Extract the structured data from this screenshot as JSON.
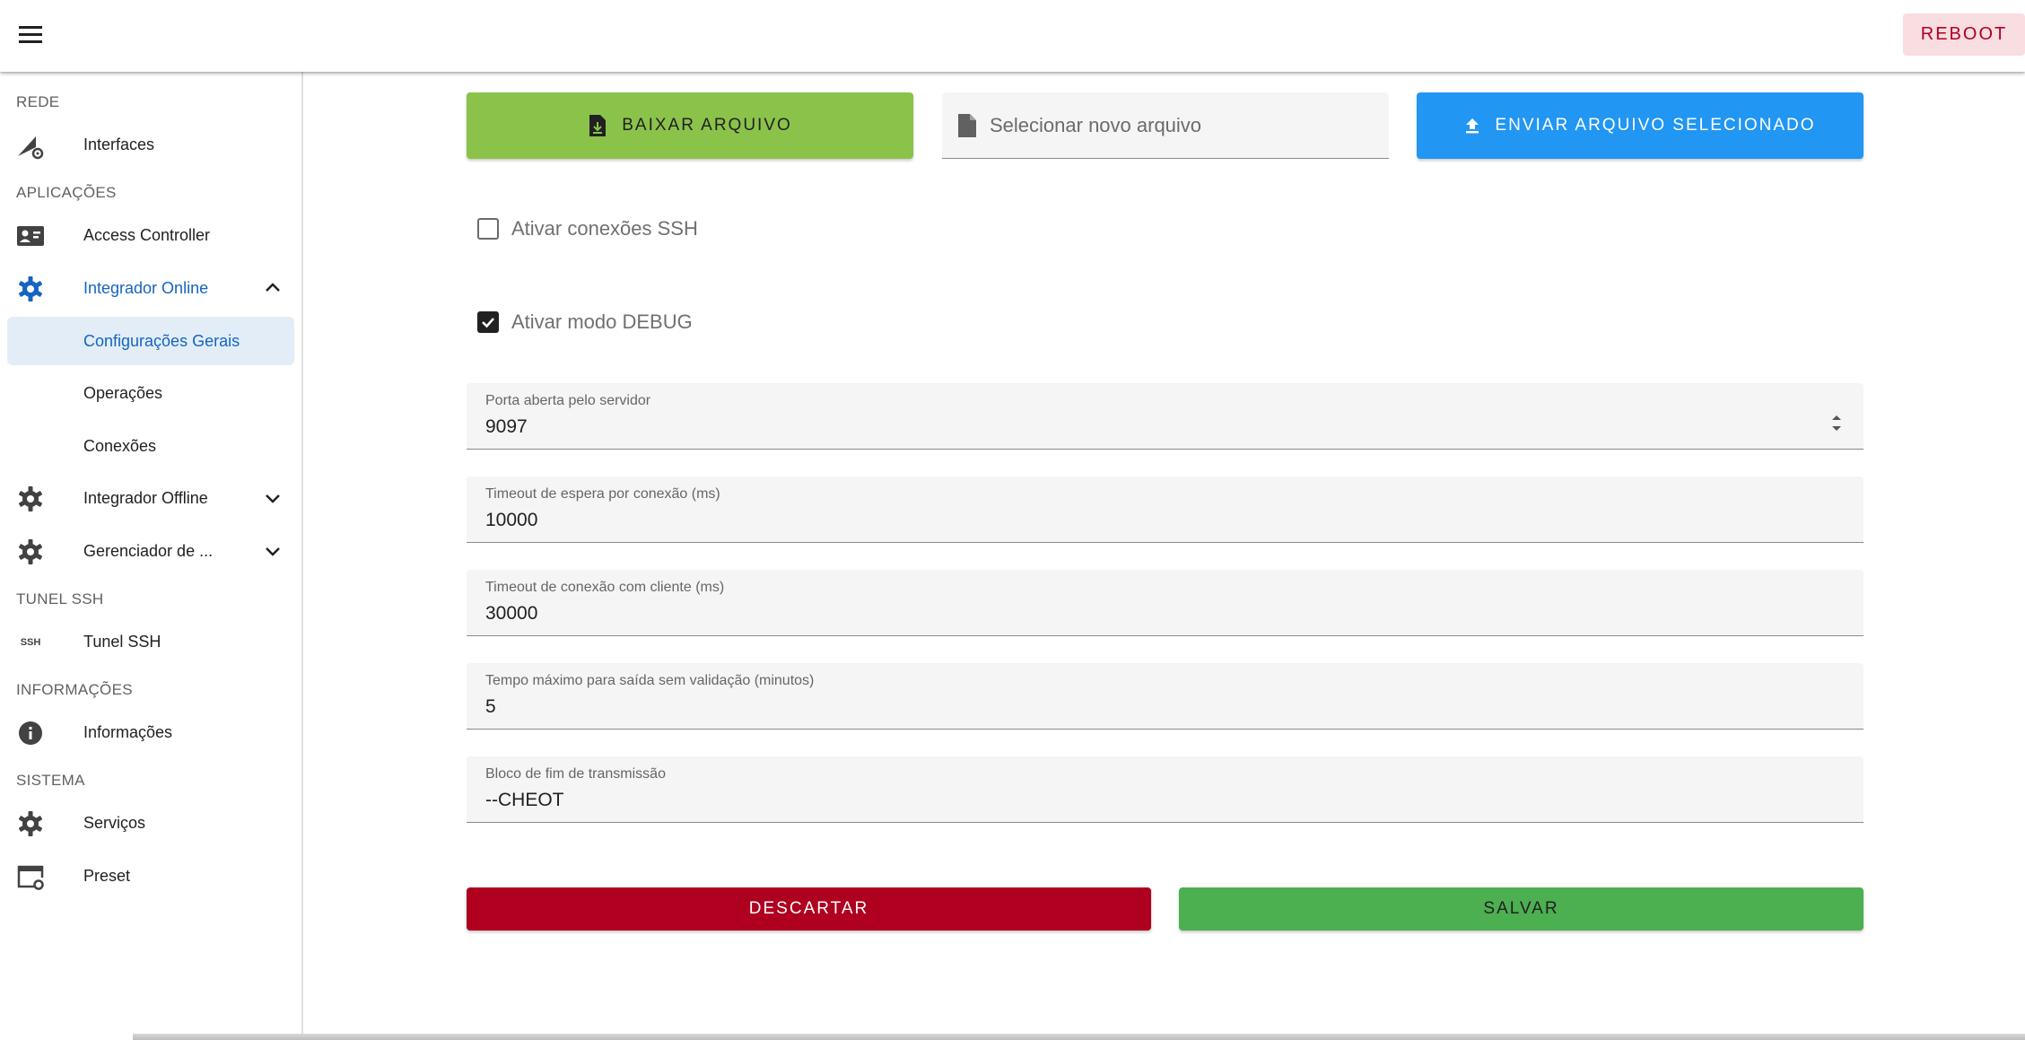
{
  "appbar": {
    "reboot_label": "REBOOT",
    "menu_icon": "menu-icon"
  },
  "sidebar": {
    "sections": {
      "rede": "REDE",
      "aplicacoes": "APLICAÇÕES",
      "tunel": "TUNEL SSH",
      "informacoes": "INFORMAÇÕES",
      "sistema": "SISTEMA"
    },
    "items": {
      "interfaces": "Interfaces",
      "access_controller": "Access Controller",
      "integrador_online": "Integrador Online",
      "configuracoes_gerais": "Configurações Gerais",
      "operacoes": "Operações",
      "conexoes": "Conexões",
      "integrador_offline": "Integrador Offline",
      "gerenciador": "Gerenciador de ...",
      "tunel_ssh": "Tunel SSH",
      "informacoes": "Informações",
      "servicos": "Serviços",
      "preset": "Preset"
    },
    "ssh_icon_text": "SSH",
    "accent_color": "#1565c0"
  },
  "main": {
    "download_label": "BAIXAR ARQUIVO",
    "file_placeholder": "Selecionar novo arquivo",
    "upload_label": "ENVIAR ARQUIVO SELECIONADO",
    "ssh_checkbox": {
      "label": "Ativar conexões SSH",
      "checked": false
    },
    "debug_checkbox": {
      "label": "Ativar modo DEBUG",
      "checked": true
    },
    "fields": {
      "porta": {
        "label": "Porta aberta pelo servidor",
        "value": "9097"
      },
      "timeout_espera": {
        "label": "Timeout de espera por conexão (ms)",
        "value": "10000"
      },
      "timeout_cliente": {
        "label": "Timeout de conexão com cliente (ms)",
        "value": "30000"
      },
      "tempo_maximo": {
        "label": "Tempo máximo para saída sem validação (minutos)",
        "value": "5"
      },
      "bloco_fim": {
        "label": "Bloco de fim de transmissão",
        "value": "--CHEOT"
      }
    },
    "discard_label": "DESCARTAR",
    "save_label": "SALVAR",
    "colors": {
      "download": "#8bc34a",
      "upload": "#2196f3",
      "discard": "#b00020",
      "save": "#4caf50"
    }
  }
}
